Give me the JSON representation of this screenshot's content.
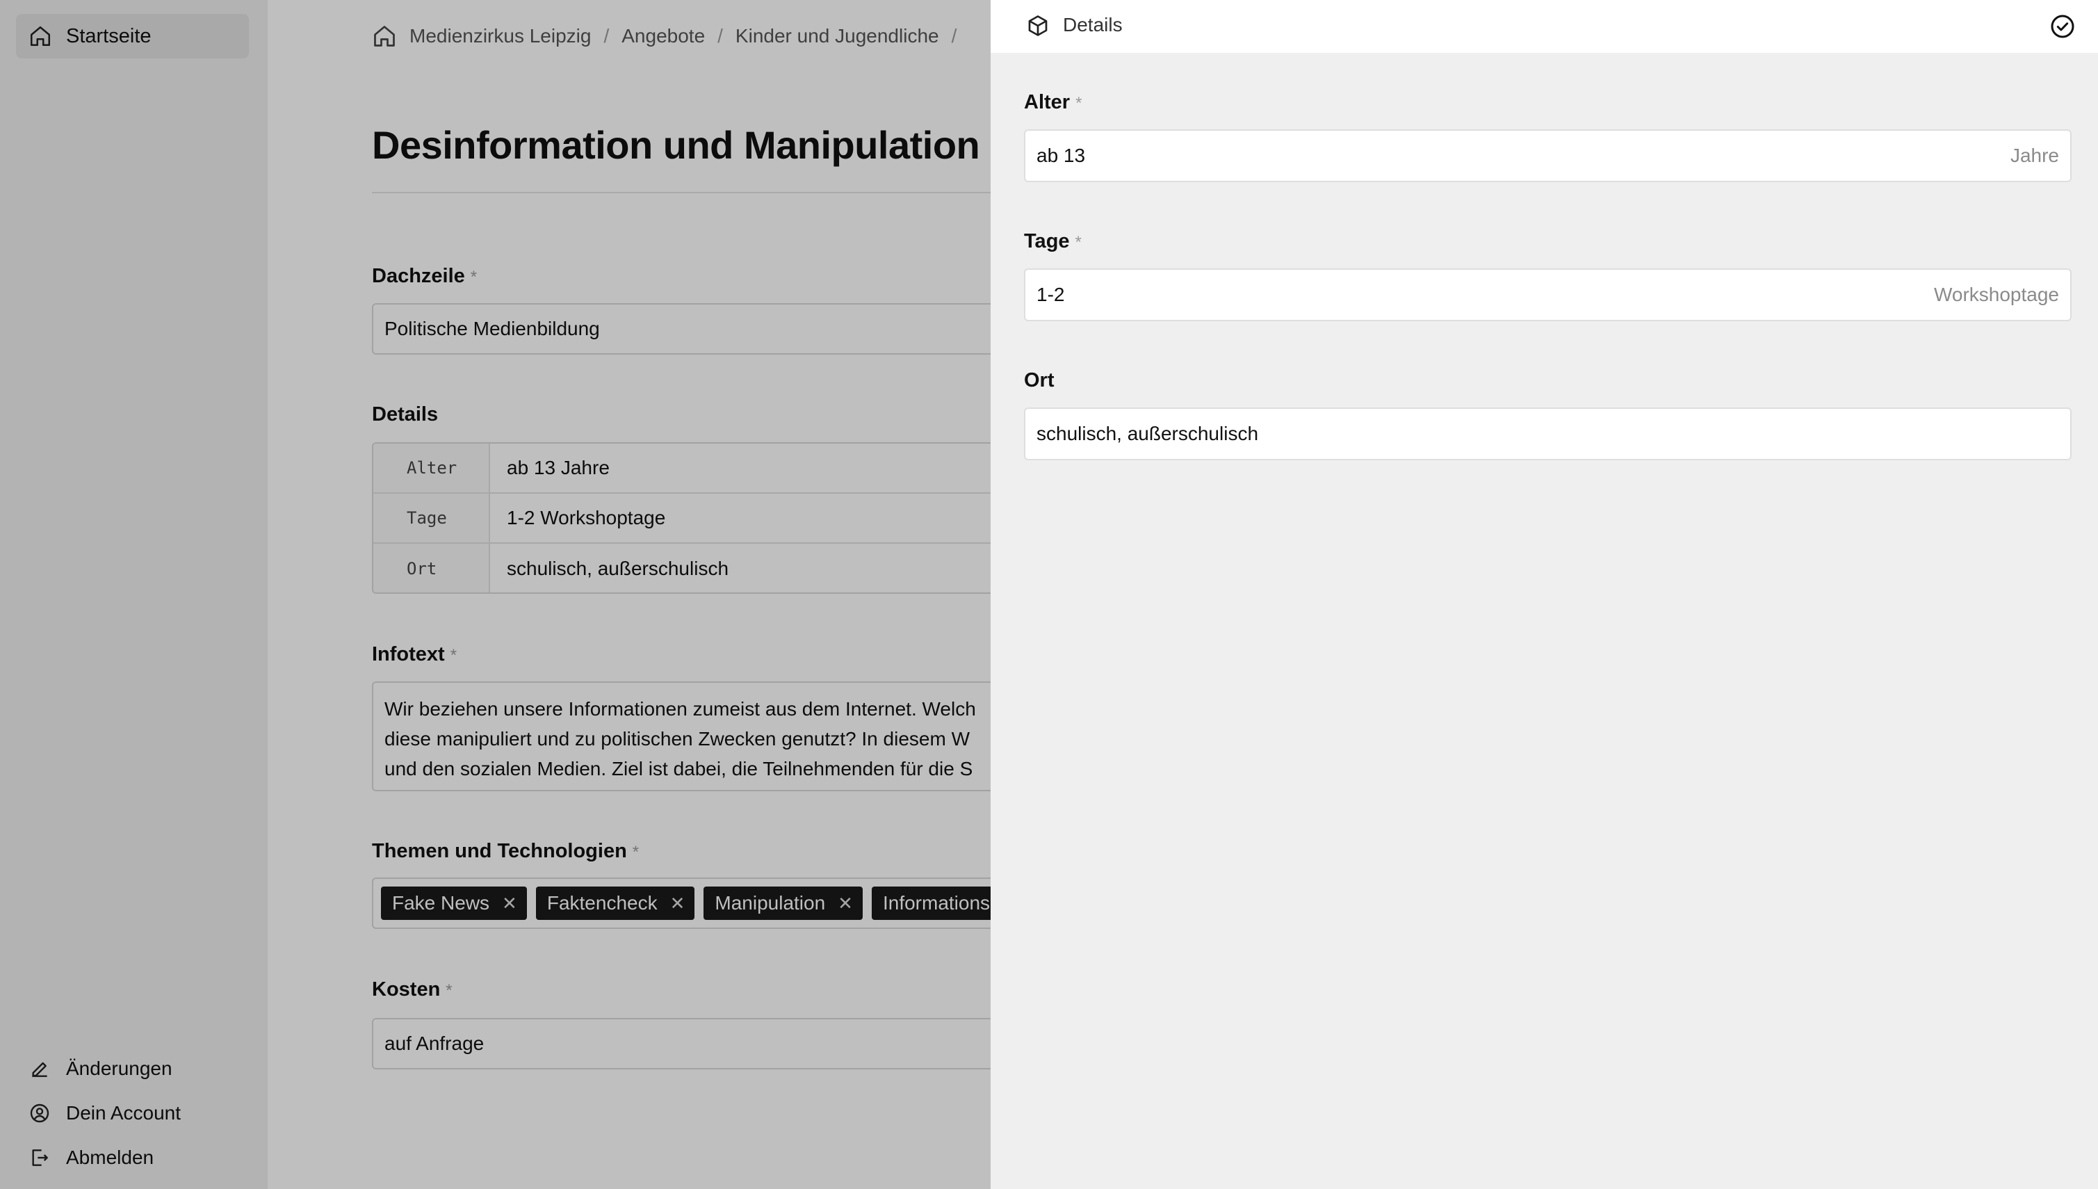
{
  "sidebar": {
    "home_label": "Startseite",
    "changes_label": "Änderungen",
    "account_label": "Dein Account",
    "logout_label": "Abmelden"
  },
  "breadcrumb": {
    "items": [
      "Medienzirkus Leipzig",
      "Angebote",
      "Kinder und Jugendliche"
    ]
  },
  "page": {
    "title": "Desinformation und Manipulation"
  },
  "form": {
    "dachzeile_label": "Dachzeile",
    "dachzeile_value": "Politische Medienbildung",
    "details_label": "Details",
    "details_rows": [
      {
        "key": "Alter",
        "value": "ab 13 Jahre"
      },
      {
        "key": "Tage",
        "value": "1-2 Workshoptage"
      },
      {
        "key": "Ort",
        "value": "schulisch, außerschulisch"
      }
    ],
    "infotext_label": "Infotext",
    "infotext_lines": [
      "Wir beziehen unsere Informationen zumeist aus dem Internet. Welch",
      "diese manipuliert und zu politischen Zwecken genutzt? In diesem W",
      "und den sozialen Medien. Ziel ist dabei, die Teilnehmenden für die S"
    ],
    "themen_label": "Themen und Technologien",
    "tags": [
      "Fake News",
      "Faktencheck",
      "Manipulation",
      "Informations"
    ],
    "kosten_label": "Kosten",
    "kosten_value": "auf Anfrage",
    "required_mark": "*"
  },
  "drawer": {
    "title": "Details",
    "fields": [
      {
        "label": "Alter",
        "required": true,
        "value": "ab 13",
        "suffix": "Jahre"
      },
      {
        "label": "Tage",
        "required": true,
        "value": "1-2",
        "suffix": "Workshoptage"
      },
      {
        "label": "Ort",
        "required": false,
        "value": "schulisch, außerschulisch",
        "suffix": ""
      }
    ]
  },
  "icons": {
    "home": "home-icon",
    "edit": "pencil-icon",
    "account": "user-circle-icon",
    "logout": "logout-icon",
    "cube": "cube-icon",
    "confirm": "check-circle-icon",
    "remove_tag": "close-icon"
  }
}
